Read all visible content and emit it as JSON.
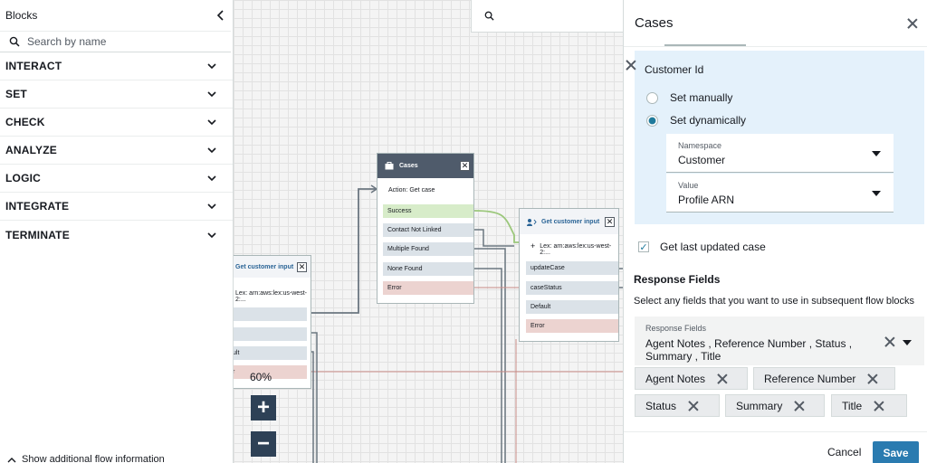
{
  "sidebar": {
    "title": "Blocks",
    "search_placeholder": "Search by name",
    "categories": [
      "INTERACT",
      "SET",
      "CHECK",
      "ANALYZE",
      "LOGIC",
      "INTEGRATE",
      "TERMINATE"
    ],
    "footer": "Show additional flow information"
  },
  "canvas": {
    "zoom": "60%",
    "cases_node": {
      "title": "Cases",
      "action": "Action: Get case",
      "ports": [
        "Success",
        "Contact Not Linked",
        "Multiple Found",
        "None Found",
        "Error"
      ]
    },
    "gci_node_right": {
      "title": "Get customer input",
      "lex": "Lex: arn:aws:lex:us-west-2:...",
      "ports": [
        "updateCase",
        "caseStatus",
        "Default",
        "Error"
      ]
    },
    "gci_node_left": {
      "title": "Get customer input",
      "lex": "Lex: arn:aws:lex:us-west-2:...",
      "ports": [
        "",
        "",
        "ult",
        "r"
      ]
    }
  },
  "panel": {
    "title": "Cases",
    "customer_id": {
      "title": "Customer Id",
      "option_manual": "Set manually",
      "option_dynamic": "Set dynamically",
      "selected": "Set dynamically",
      "namespace_label": "Namespace",
      "namespace_value": "Customer",
      "value_label": "Value",
      "value_value": "Profile ARN"
    },
    "last_updated_label": "Get last updated case",
    "last_updated_checked": true,
    "response_title": "Response Fields",
    "response_desc": "Select any fields that you want to use in subsequent flow blocks",
    "response_field_label": "Response Fields",
    "response_field_value": "Agent Notes , Reference Number , Status , Summary , Title",
    "tokens": [
      "Agent Notes",
      "Reference Number",
      "Status",
      "Summary",
      "Title"
    ],
    "cancel": "Cancel",
    "save": "Save"
  },
  "colors": {
    "accent": "#2a7bb0",
    "node_header": "#4a5568",
    "info_bg": "#e4f1fb"
  }
}
